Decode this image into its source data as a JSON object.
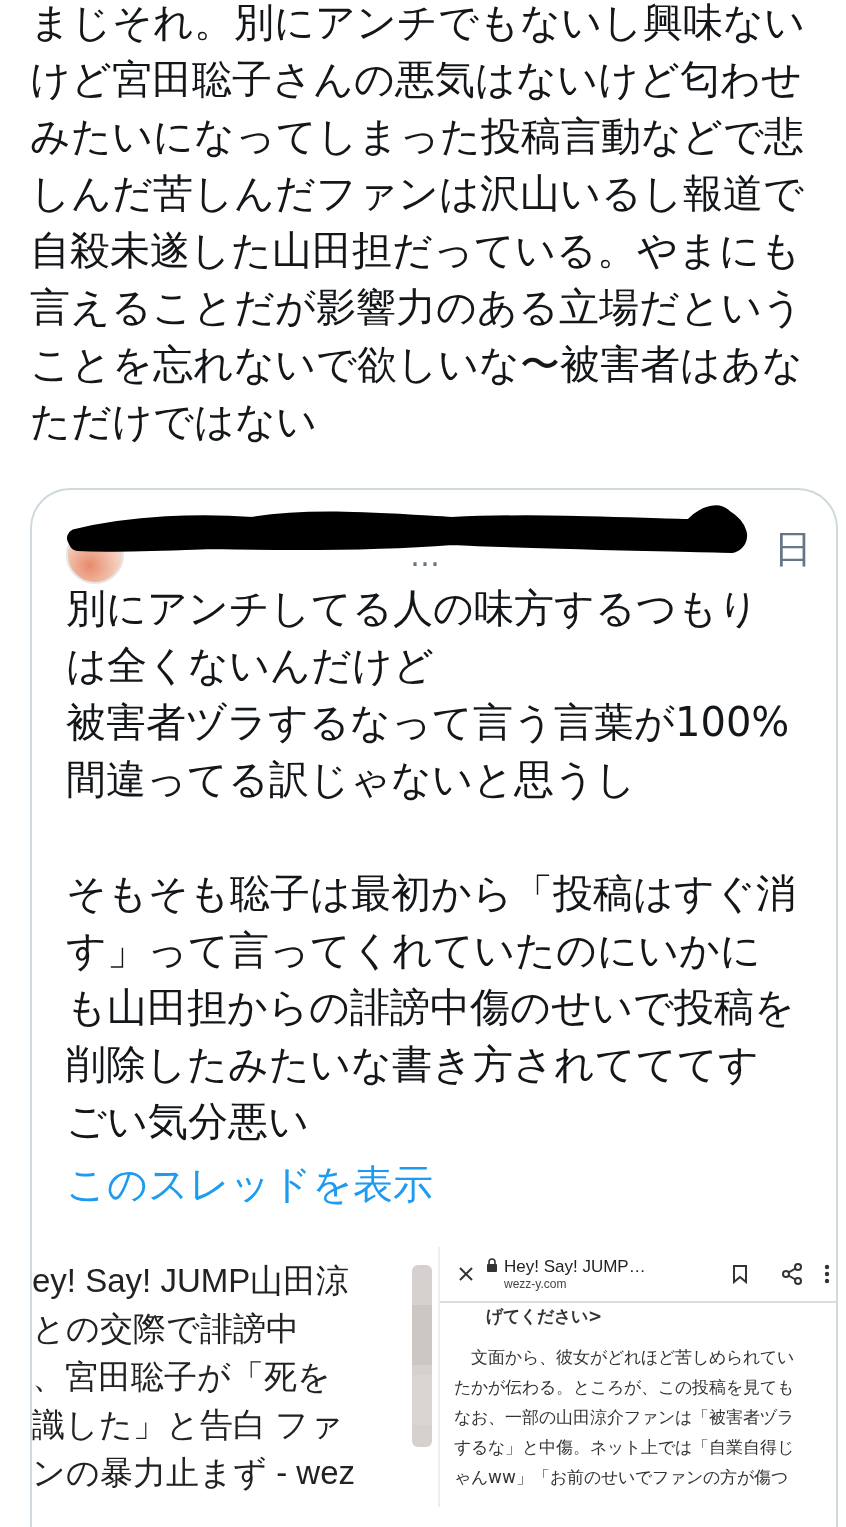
{
  "post": {
    "text": "まじそれ。別にアンチでもないし興味ないけど宮田聡子さんの悪気はないけど匂わせみたいになってしまった投稿言動などで悲しんだ苦しんだファンは沢山いるし報道で自殺未遂した山田担だっている。やまにも言えることだが影響力のある立場だということを忘れないで欲しいな〜被害者はあなただけではない"
  },
  "quote": {
    "header": {
      "ellipsis": "…",
      "date_fragment": "日"
    },
    "paragraphs": [
      [
        "別にアンチしてる人の味方するつもりは全くないんだけど",
        "被害者ヅラするなって言う言葉が100%間違ってる訳じゃないと思うし"
      ],
      [
        "そもそも聡子は最初から「投稿はすぐ消す」って言ってくれていたのにいかにも山田担からの誹謗中傷のせいで投稿を削除したみたいな書き方されてててすごい気分悪い"
      ]
    ],
    "show_thread_link": "このスレッドを表示",
    "images": [
      {
        "kind": "article",
        "lines": [
          "ey! Say! JUMP山田涼",
          "との交際で誹謗中",
          "、宮田聡子が「死を",
          "識した」と告白 ファ",
          "ンの暴力止まず - wez"
        ]
      },
      {
        "kind": "picture"
      },
      {
        "kind": "browser",
        "title": "Hey! Say! JUMP…",
        "domain": "wezz-y.com",
        "heading": "げてください>",
        "body": "　文面から、彼女がどれほど苦しめられていたかが伝わる。ところが、この投稿を見てもなお、一部の山田涼介ファンは「被害者ヅラするな」と中傷。ネット上では「自業自得じゃんww」「お前のせいでファンの方が傷つ"
      }
    ]
  }
}
